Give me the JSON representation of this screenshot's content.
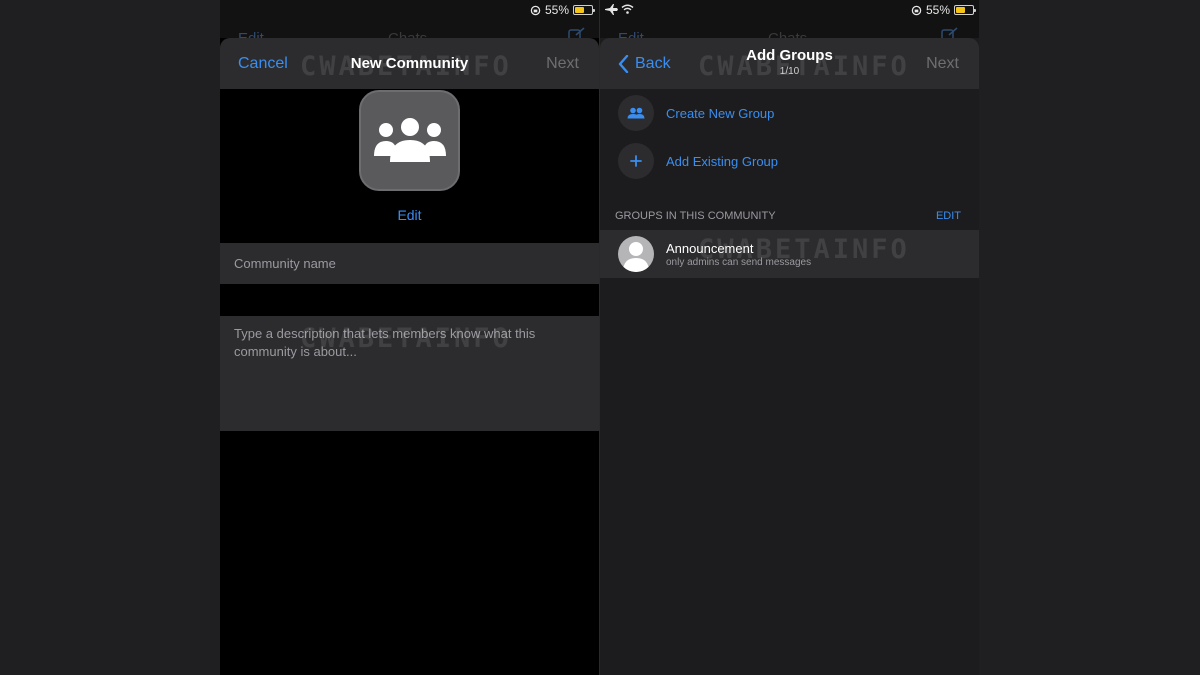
{
  "left": {
    "ghost": {
      "edit_label": "Edit",
      "title": "Chats"
    },
    "status": {
      "battery": "55%"
    },
    "nav": {
      "cancel_label": "Cancel",
      "title": "New Community",
      "next_label": "Next"
    },
    "watermark": "CWABETAINFO",
    "photo": {
      "icon": "community-people-icon",
      "edit_label": "Edit"
    },
    "name_field": {
      "placeholder": "Community name"
    },
    "description_field": {
      "placeholder": "Type a description that lets members know what this community is about..."
    }
  },
  "right": {
    "ghost": {
      "edit_label": "Edit",
      "title": "Chats"
    },
    "status": {
      "battery": "55%"
    },
    "nav": {
      "back_label": "Back",
      "title": "Add Groups",
      "subtitle": "1/10",
      "next_label": "Next"
    },
    "watermark": "CWABETAINFO",
    "actions": [
      {
        "label": "Create New Group",
        "icon": "group-icon"
      },
      {
        "label": "Add Existing Group",
        "icon": "plus-icon"
      }
    ],
    "section": {
      "header": "GROUPS IN THIS COMMUNITY",
      "edit_label": "EDIT"
    },
    "groups": [
      {
        "title": "Announcement",
        "subtitle": "only admins can send messages",
        "icon": "person-avatar-icon"
      }
    ]
  },
  "colors": {
    "accent": "#3a8ef0",
    "background": "#1c1c1e",
    "sheet_bar": "#2c2c2e"
  }
}
